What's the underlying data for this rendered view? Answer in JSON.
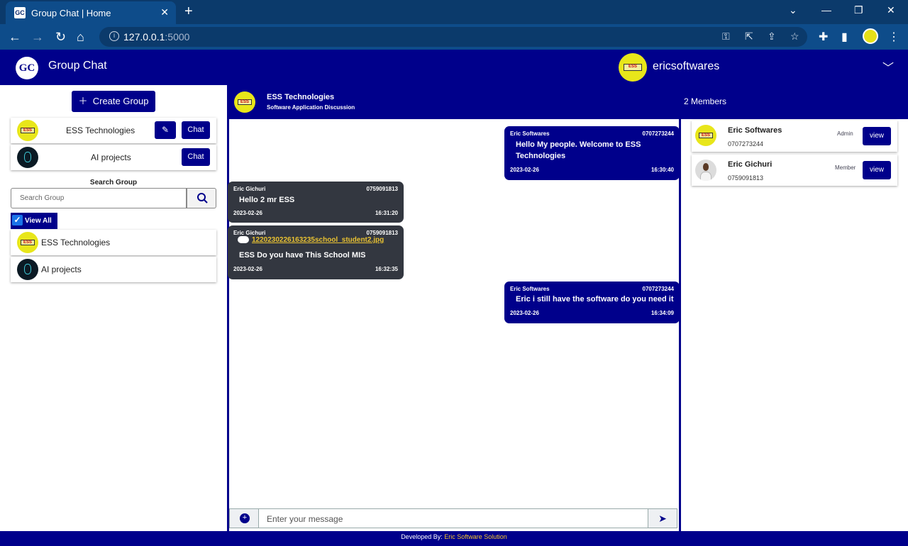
{
  "browser": {
    "tab_title": "Group Chat | Home",
    "tab_favicon": "GC",
    "url_host": "127.0.0.1",
    "url_port": ":5000"
  },
  "app": {
    "logo_text": "GC",
    "title": "Group Chat",
    "username": "ericsoftwares"
  },
  "sidebar": {
    "create_label": "Create Group",
    "groups": [
      {
        "name": "ESS Technologies",
        "edit": true,
        "chat_label": "Chat"
      },
      {
        "name": "AI projects",
        "edit": false,
        "chat_label": "Chat"
      }
    ],
    "search_label": "Search Group",
    "search_placeholder": "Search Group",
    "view_all_label": "View All",
    "view_all_checked": true,
    "list": [
      {
        "name": "ESS Technologies"
      },
      {
        "name": "AI projects"
      }
    ]
  },
  "chat": {
    "group_name": "ESS Technologies",
    "group_desc": "Software Application Discussion",
    "members_count": "2 Members",
    "messages": [
      {
        "direction": "out",
        "sender": "Eric Softwares",
        "phone": "0707273244",
        "text": "Hello My people. Welcome to ESS Technologies",
        "date": "2023-02-26",
        "time": "16:30:40"
      },
      {
        "direction": "in",
        "sender": "Eric Gichuri",
        "phone": "0759091813",
        "text": "Hello 2 mr ESS",
        "date": "2023-02-26",
        "time": "16:31:20"
      },
      {
        "direction": "in",
        "sender": "Eric Gichuri",
        "phone": "0759091813",
        "file": "1220230226163235school_student2.jpg",
        "text": "ESS Do you have This School MIS",
        "date": "2023-02-26",
        "time": "16:32:35"
      },
      {
        "direction": "out",
        "sender": "Eric Softwares",
        "phone": "0707273244",
        "text": "Eric i still have the software do you need it",
        "date": "2023-02-26",
        "time": "16:34:09"
      }
    ],
    "input_placeholder": "Enter your message"
  },
  "members": [
    {
      "name": "Eric Softwares",
      "phone": "0707273244",
      "role": "Admin",
      "view_label": "view"
    },
    {
      "name": "Eric Gichuri",
      "phone": "0759091813",
      "role": "Member",
      "view_label": "view"
    }
  ],
  "footer": {
    "prefix": "Developed By:",
    "brand": "Eric Software Solution"
  },
  "colors": {
    "primary": "#00008b",
    "incoming_bubble": "#333740",
    "browser_frame": "#0e4c8a",
    "link_accent": "#f2c230"
  }
}
